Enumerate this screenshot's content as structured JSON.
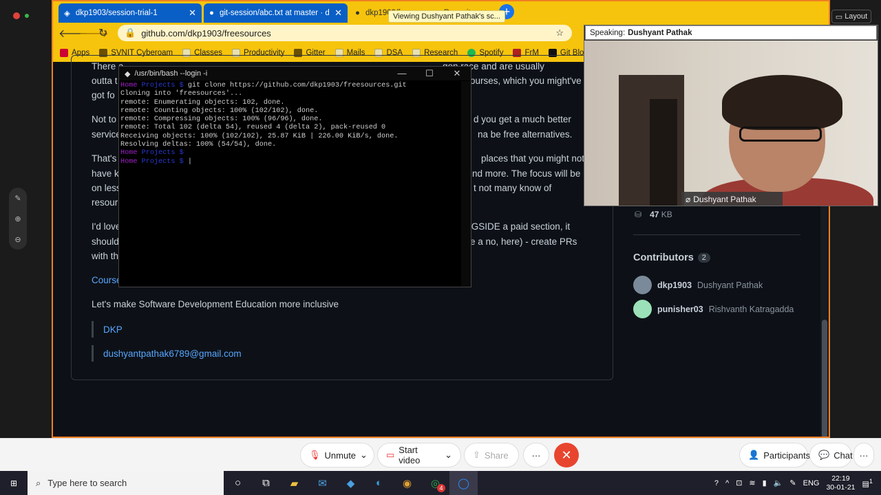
{
  "zoom": {
    "layout_label": "Layout",
    "speaking_label": "Speaking:",
    "speaker_name": "Dushyant Pathak",
    "video_name": "Dushyant Pathak",
    "viewing_tooltip": "Viewing Dushyant Pathak's sc...",
    "bottom": {
      "unmute": "Unmute",
      "start_video": "Start video",
      "share": "Share",
      "more": "···",
      "participants": "Participants",
      "chat": "Chat",
      "overflow": "···"
    }
  },
  "browser": {
    "tabs": [
      {
        "title": "dkp1903/session-trial-1"
      },
      {
        "title": "git-session/abc.txt at master · dk"
      },
      {
        "title": "dkp1903/freesources: Reposito"
      }
    ],
    "url": "github.com/dkp1903/freesources",
    "bookmarks": [
      "Apps",
      "SVNIT Cyberoam",
      "Classes",
      "Productivity",
      "Gitter",
      "Mails",
      "DSA",
      "Research",
      "Spotify",
      "FrM",
      "Git Blo"
    ]
  },
  "readme": {
    "lines": [
      {
        "text": "There a",
        "tail": "gon race and are usually"
      },
      {
        "text": "outta t",
        "tail": "ourses, which you might've"
      },
      {
        "text": "got fo",
        "tail": ""
      },
      {
        "text": "Not to",
        "tail": "d you get a much better"
      },
      {
        "text": "service",
        "tail": "na be free alternatives."
      },
      {
        "text": "That's",
        "tail": "places that you might not"
      },
      {
        "text": "have k",
        "tail": "nd more. The focus will be"
      },
      {
        "text": "on less",
        "tail": "t not many know of"
      },
      {
        "text": "resour",
        "tail": ""
      },
      {
        "text": "I'd love",
        "tail": "NGSIDE a paid section, it"
      },
      {
        "text": "should",
        "tail": "are a no, here) - create PRs"
      },
      {
        "text": "with th",
        "tail": ""
      }
    ],
    "courses_link": "Course",
    "inclusive": "Let's make Software Development Education more inclusive",
    "quote1": "DKP",
    "quote2": "dushyantpathak6789@gmail.com"
  },
  "sidebar": {
    "size_value": "47",
    "size_unit": "KB",
    "contributors_title": "Contributors",
    "contributors_count": "2",
    "contributors": [
      {
        "login": "dkp1903",
        "name": "Dushyant Pathak"
      },
      {
        "login": "punisher03",
        "name": "Rishvanth Katragadda"
      }
    ]
  },
  "terminal": {
    "title": "/usr/bin/bash --login -i",
    "prompt_dir": "Home",
    "prompt_path": "Projects $",
    "command": "git clone https://github.com/dkp1903/freesources.git",
    "output": [
      "Cloning into 'freesources'...",
      "remote: Enumerating objects: 102, done.",
      "remote: Counting objects: 100% (102/102), done.",
      "remote: Compressing objects: 100% (96/96), done.",
      "remote: Total 102 (delta 54), reused 4 (delta 2), pack-reused 0",
      "Receiving objects: 100% (102/102), 25.87 KiB | 226.00 KiB/s, done.",
      "Resolving deltas: 100% (54/54), done."
    ]
  },
  "taskbar": {
    "search_placeholder": "Type here to search",
    "lang": "ENG",
    "time": "22:19",
    "date": "30-01-21",
    "whatsapp_badge": "4",
    "notif_count": "1"
  }
}
